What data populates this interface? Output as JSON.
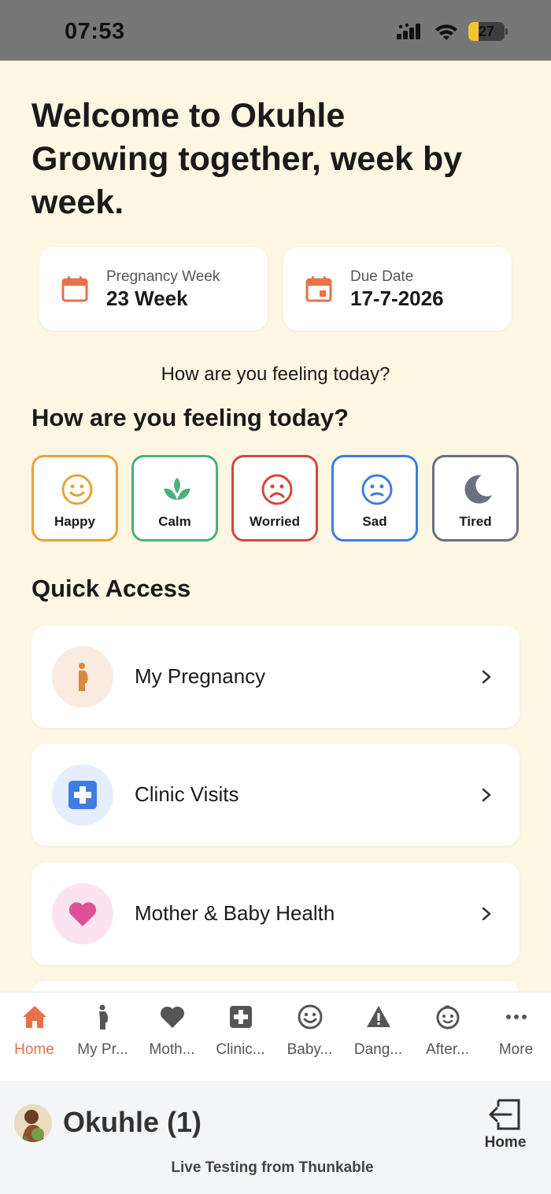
{
  "status": {
    "time": "07:53",
    "battery": "27"
  },
  "welcome": {
    "line1": "Welcome to Okuhle",
    "line2": "Growing together, week by week."
  },
  "cards": {
    "week": {
      "label": "Pregnancy Week",
      "value": "23 Week",
      "icon": "calendar-icon"
    },
    "due": {
      "label": "Due Date",
      "value": "17-7-2026",
      "icon": "calendar-event-icon"
    }
  },
  "feeling": {
    "subtitle": "How are you feeling today?",
    "title": "How are you feeling today?",
    "moods": [
      {
        "label": "Happy",
        "color": "#e8a23a",
        "icon": "smile-icon"
      },
      {
        "label": "Calm",
        "color": "#4caf7d",
        "icon": "leaf-icon"
      },
      {
        "label": "Worried",
        "color": "#d9443d",
        "icon": "frown-icon"
      },
      {
        "label": "Sad",
        "color": "#3f7de0",
        "icon": "sad-icon"
      },
      {
        "label": "Tired",
        "color": "#6b7080",
        "icon": "moon-icon"
      }
    ]
  },
  "quick_access": {
    "title": "Quick Access",
    "items": [
      {
        "label": "My Pregnancy",
        "icon": "pregnant-icon",
        "bg": "#f9ebe0",
        "color": "#d9893a"
      },
      {
        "label": "Clinic Visits",
        "icon": "medical-cross-icon",
        "bg": "#e4eefc",
        "color": "#3f7de0"
      },
      {
        "label": "Mother & Baby Health",
        "icon": "heart-icon",
        "bg": "#fbe4ef",
        "color": "#e04f9a"
      }
    ]
  },
  "tabs": [
    {
      "label": "Home",
      "icon": "home-icon",
      "active": true
    },
    {
      "label": "My Pr...",
      "icon": "pregnant-icon"
    },
    {
      "label": "Moth...",
      "icon": "heart-icon"
    },
    {
      "label": "Clinic...",
      "icon": "medical-cross-icon"
    },
    {
      "label": "Baby...",
      "icon": "smile-icon"
    },
    {
      "label": "Dang...",
      "icon": "warning-icon"
    },
    {
      "label": "After...",
      "icon": "baby-icon"
    },
    {
      "label": "More",
      "icon": "more-icon"
    }
  ],
  "thunkable": {
    "title": "Okuhle (1)",
    "home_label": "Home",
    "subtitle": "Live Testing from Thunkable"
  },
  "colors": {
    "accent": "#e8714a",
    "background": "#fdf6e3"
  }
}
